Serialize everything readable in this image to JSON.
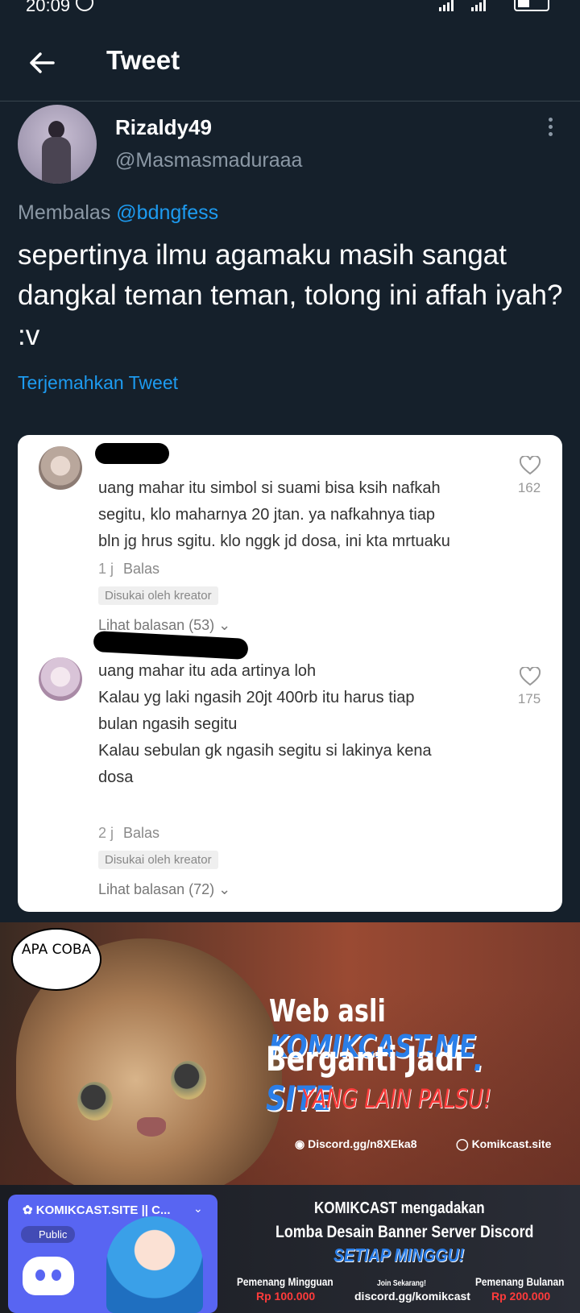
{
  "status_bar": {
    "time": "20:09"
  },
  "header": {
    "title": "Tweet"
  },
  "author": {
    "display_name": "Rizaldy49",
    "handle": "@Masmasmaduraaa"
  },
  "tweet": {
    "reply_prefix": "Membalas",
    "reply_mention": "@bdngfess",
    "text": "sepertinya ilmu agamaku masih sangat dangkal teman teman, tolong ini affah iyah?  :v",
    "translate_label": "Terjemahkan Tweet"
  },
  "screenshot": {
    "comments": [
      {
        "lines": [
          "uang mahar itu simbol si suami bisa ksih nafkah",
          "segitu, klo maharnya 20 jtan. ya nafkahnya tiap",
          "bln jg hrus sgitu. klo nggk jd dosa, ini kta mrtuaku"
        ],
        "time": "1 j",
        "reply": "Balas",
        "badge": "Disukai oleh kreator",
        "more": "Lihat balasan (53)",
        "likes": "162"
      },
      {
        "lines": [
          "uang mahar itu ada artinya loh",
          "Kalau yg laki ngasih 20jt 400rb itu harus tiap",
          "bulan ngasih segitu",
          "Kalau sebulan gk ngasih segitu si lakinya kena",
          "dosa"
        ],
        "time": "2 j",
        "reply": "Balas",
        "badge": "Disukai oleh kreator",
        "more": "Lihat balasan (72)",
        "likes": "175"
      }
    ]
  },
  "banner": {
    "bubble": "APA COBA",
    "line1_a": "Web asli",
    "line1_b": "KOMIKCAST.ME",
    "line2_a": "Berganti Jadi",
    "line2_b": ". SITE",
    "warning": "YANG LAIN PALSU!",
    "discord_link": "Discord.gg/n8XEka8",
    "site_link": "Komikcast.site"
  },
  "ad2": {
    "card_title": "KOMIKCAST.SITE || C...",
    "public_label": "Public",
    "headline1": "KOMIKCAST mengadakan",
    "headline2": "Lomba Desain Banner Server Discord",
    "headline3": "SETIAP MINGGU!",
    "weekly_label": "Pemenang Mingguan",
    "weekly_prize": "Rp 100.000",
    "join_label": "Join Sekarang!",
    "join_link": "discord.gg/komikcast",
    "monthly_label": "Pemenang Bulanan",
    "monthly_prize": "Rp 200.000"
  }
}
